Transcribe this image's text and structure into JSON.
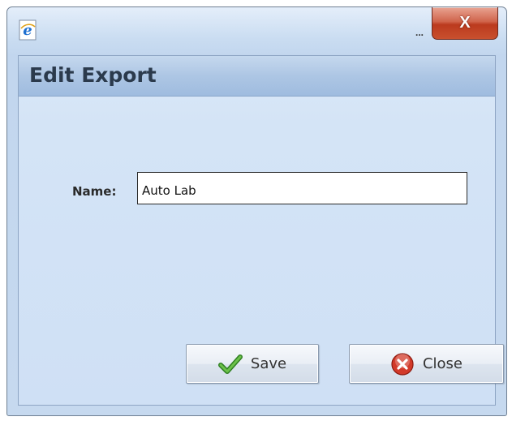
{
  "window": {
    "title_ellipsis": "...",
    "close_label": "X"
  },
  "header": {
    "title": "Edit Export"
  },
  "form": {
    "name_label": "Name:",
    "name_value": "Auto Lab"
  },
  "buttons": {
    "save_label": "Save",
    "close_label": "Close"
  },
  "icons": {
    "app": "internet-explorer-icon",
    "save": "checkmark-icon",
    "close": "close-circle-icon"
  },
  "colors": {
    "close_button": "#c94a2c",
    "header_bar": "#adc6e4",
    "client_bg": "#d4e4f6",
    "check_green": "#3a9a2a",
    "close_red": "#d23a2a"
  }
}
